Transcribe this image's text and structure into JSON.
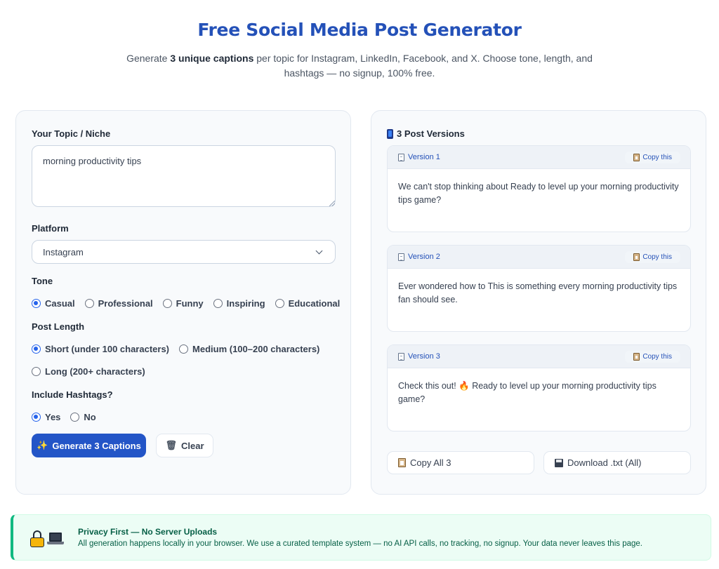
{
  "header": {
    "title": "Free Social Media Post Generator",
    "subtitle_pre": "Generate ",
    "subtitle_bold": "3 unique captions",
    "subtitle_post": " per topic for Instagram, LinkedIn, Facebook, and X. Choose tone, length, and hashtags — no signup, 100% free."
  },
  "form": {
    "topic_label": "Your Topic / Niche",
    "topic_value": "morning productivity tips",
    "platform_label": "Platform",
    "platform_value": "Instagram",
    "tone_label": "Tone",
    "tone_options": [
      "Casual",
      "Professional",
      "Funny",
      "Inspiring",
      "Educational"
    ],
    "tone_selected": "Casual",
    "length_label": "Post Length",
    "length_options": [
      "Short (under 100 characters)",
      "Medium (100–200 characters)",
      "Long (200+ characters)"
    ],
    "length_selected": "Short (under 100 characters)",
    "hashtags_label": "Include Hashtags?",
    "hashtags_options": [
      "Yes",
      "No"
    ],
    "hashtags_selected": "Yes",
    "generate_label": "Generate 3 Captions",
    "clear_label": "Clear"
  },
  "results": {
    "title": "3 Post Versions",
    "copy_label": "Copy this",
    "versions": [
      {
        "name": "Version 1",
        "text": "We can't stop thinking about Ready to level up your morning productivity tips game?"
      },
      {
        "name": "Version 2",
        "text": "Ever wondered how to This is something every morning productivity tips fan should see."
      },
      {
        "name": "Version 3",
        "text": "Check this out! 🔥 Ready to level up your morning productivity tips game?"
      }
    ],
    "copy_all_label": "Copy All 3",
    "download_label": "Download .txt (All)"
  },
  "privacy": {
    "title": "Privacy First — No Server Uploads",
    "text": "All generation happens locally in your browser. We use a curated template system — no AI API calls, no tracking, no signup. Your data never leaves this page."
  },
  "colors": {
    "accent": "#2355c7",
    "title": "#2451b8",
    "success_bg": "#ecfdf5",
    "success_border": "#10b981"
  }
}
